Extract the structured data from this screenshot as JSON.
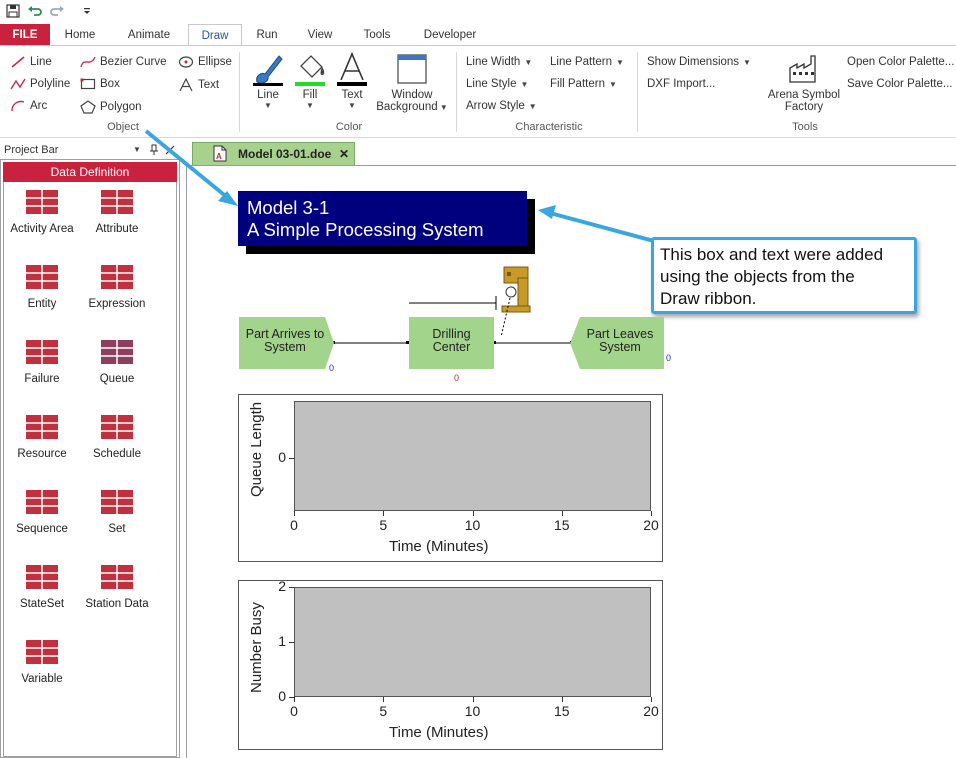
{
  "ribbon": {
    "tabs": [
      "FILE",
      "Home",
      "Animate",
      "Draw",
      "Run",
      "View",
      "Tools",
      "Developer"
    ],
    "object_group": {
      "label": "Object",
      "buttons": [
        "Line",
        "Bezier Curve",
        "Ellipse",
        "Polyline",
        "Box",
        "Text",
        "Arc",
        "Polygon"
      ]
    },
    "color_group": {
      "label": "Color",
      "buttons": [
        "Line",
        "Fill",
        "Text"
      ],
      "window_background_line1": "Window",
      "window_background_line2": "Background"
    },
    "characteristic_group": {
      "label": "Characteristic",
      "buttons": [
        "Line Width",
        "Line Pattern",
        "Line Style",
        "Fill Pattern",
        "Arrow Style"
      ]
    },
    "tools_group": {
      "label": "Tools",
      "show_dimensions": "Show Dimensions",
      "dxf_import": "DXF Import...",
      "arena_symbol_factory_line1": "Arena Symbol",
      "arena_symbol_factory_line2": "Factory",
      "open_color_palette": "Open Color Palette...",
      "save_color_palette": "Save Color Palette..."
    }
  },
  "project_bar": {
    "title": "Project Bar",
    "panel_title": "Data Definition",
    "modules": [
      "Activity Area",
      "Attribute",
      "Entity",
      "Expression",
      "Failure",
      "Queue",
      "Resource",
      "Schedule",
      "Sequence",
      "Set",
      "StateSet",
      "Station Data",
      "Variable"
    ]
  },
  "document_tab": {
    "label": "Model 03-01.doe",
    "close": "✕"
  },
  "canvas": {
    "title_line1": "Model 3-1",
    "title_line2": "A Simple Processing System",
    "callout_text_line1": "This box and text were added",
    "callout_text_line2": "using the objects from the",
    "callout_text_line3": "Draw ribbon.",
    "flow_modules": [
      {
        "line1": "Part Arrives to",
        "line2": "System",
        "counter": "0"
      },
      {
        "line1": "Drilling",
        "line2": "Center",
        "counter": "0"
      },
      {
        "line1": "Part Leaves",
        "line2": "System",
        "counter": "0"
      }
    ]
  },
  "colors": {
    "file_tab": "#c8223f",
    "data_definition": "#c8223f",
    "title_box": "#00007e",
    "callout_border": "#3aa6dd",
    "flow_module": "#a3d48b",
    "plot_area": "#c0c0c0",
    "doc_tab": "#a9d18e"
  },
  "chart_data": [
    {
      "type": "line",
      "title": "",
      "xlabel": "Time (Minutes)",
      "ylabel": "Queue Length",
      "xlim": [
        0,
        20
      ],
      "ylim": [
        0,
        0
      ],
      "x_ticks": [
        "0",
        "5",
        "10",
        "15",
        "20"
      ],
      "y_ticks": [
        "0"
      ],
      "series": [],
      "grid": false
    },
    {
      "type": "line",
      "title": "",
      "xlabel": "Time (Minutes)",
      "ylabel": "Number Busy",
      "xlim": [
        0,
        20
      ],
      "ylim": [
        0,
        2
      ],
      "x_ticks": [
        "0",
        "5",
        "10",
        "15",
        "20"
      ],
      "y_ticks": [
        "0",
        "1",
        "2"
      ],
      "series": [],
      "grid": false
    }
  ]
}
